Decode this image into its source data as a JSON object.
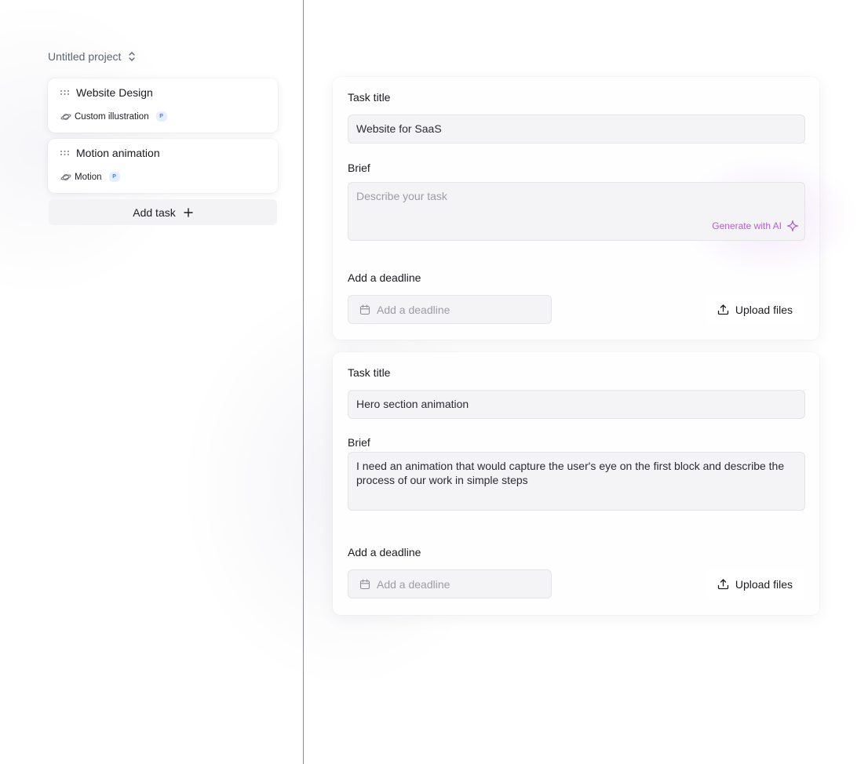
{
  "sidebar": {
    "project_name": "Untitled project",
    "tasks": [
      {
        "title": "Website Design",
        "category": "Custom illustration",
        "badge": "P"
      },
      {
        "title": "Motion animation",
        "category": "Motion",
        "badge": "P"
      }
    ],
    "add_task_label": "Add task"
  },
  "forms": [
    {
      "task_title_label": "Task title",
      "task_title_value": "Website for SaaS",
      "brief_label": "Brief",
      "brief_value": "",
      "brief_placeholder": "Describe your task",
      "generate_ai_label": "Generate with AI",
      "deadline_label": "Add a deadline",
      "deadline_placeholder": "Add a deadline",
      "upload_label": "Upload files"
    },
    {
      "task_title_label": "Task title",
      "task_title_value": "Hero section animation",
      "brief_label": "Brief",
      "brief_value": "I need an animation that would capture the user's eye on the first block and describe the process of our work in simple steps",
      "deadline_label": "Add a deadline",
      "deadline_placeholder": "Add a deadline",
      "upload_label": "Upload files"
    }
  ],
  "colors": {
    "accent_ai": "#b15fd6",
    "badge_bg": "#e6efff",
    "badge_text": "#4a7ee8",
    "input_bg": "#f4f3f6",
    "divider": "#8c8c92"
  },
  "icons": {
    "project_switcher": "chevron-up-down-icon",
    "drag": "drag-handle-icon",
    "category": "planet-icon",
    "add": "plus-icon",
    "ai": "sparkle-icon",
    "calendar": "calendar-icon",
    "upload": "upload-icon"
  }
}
